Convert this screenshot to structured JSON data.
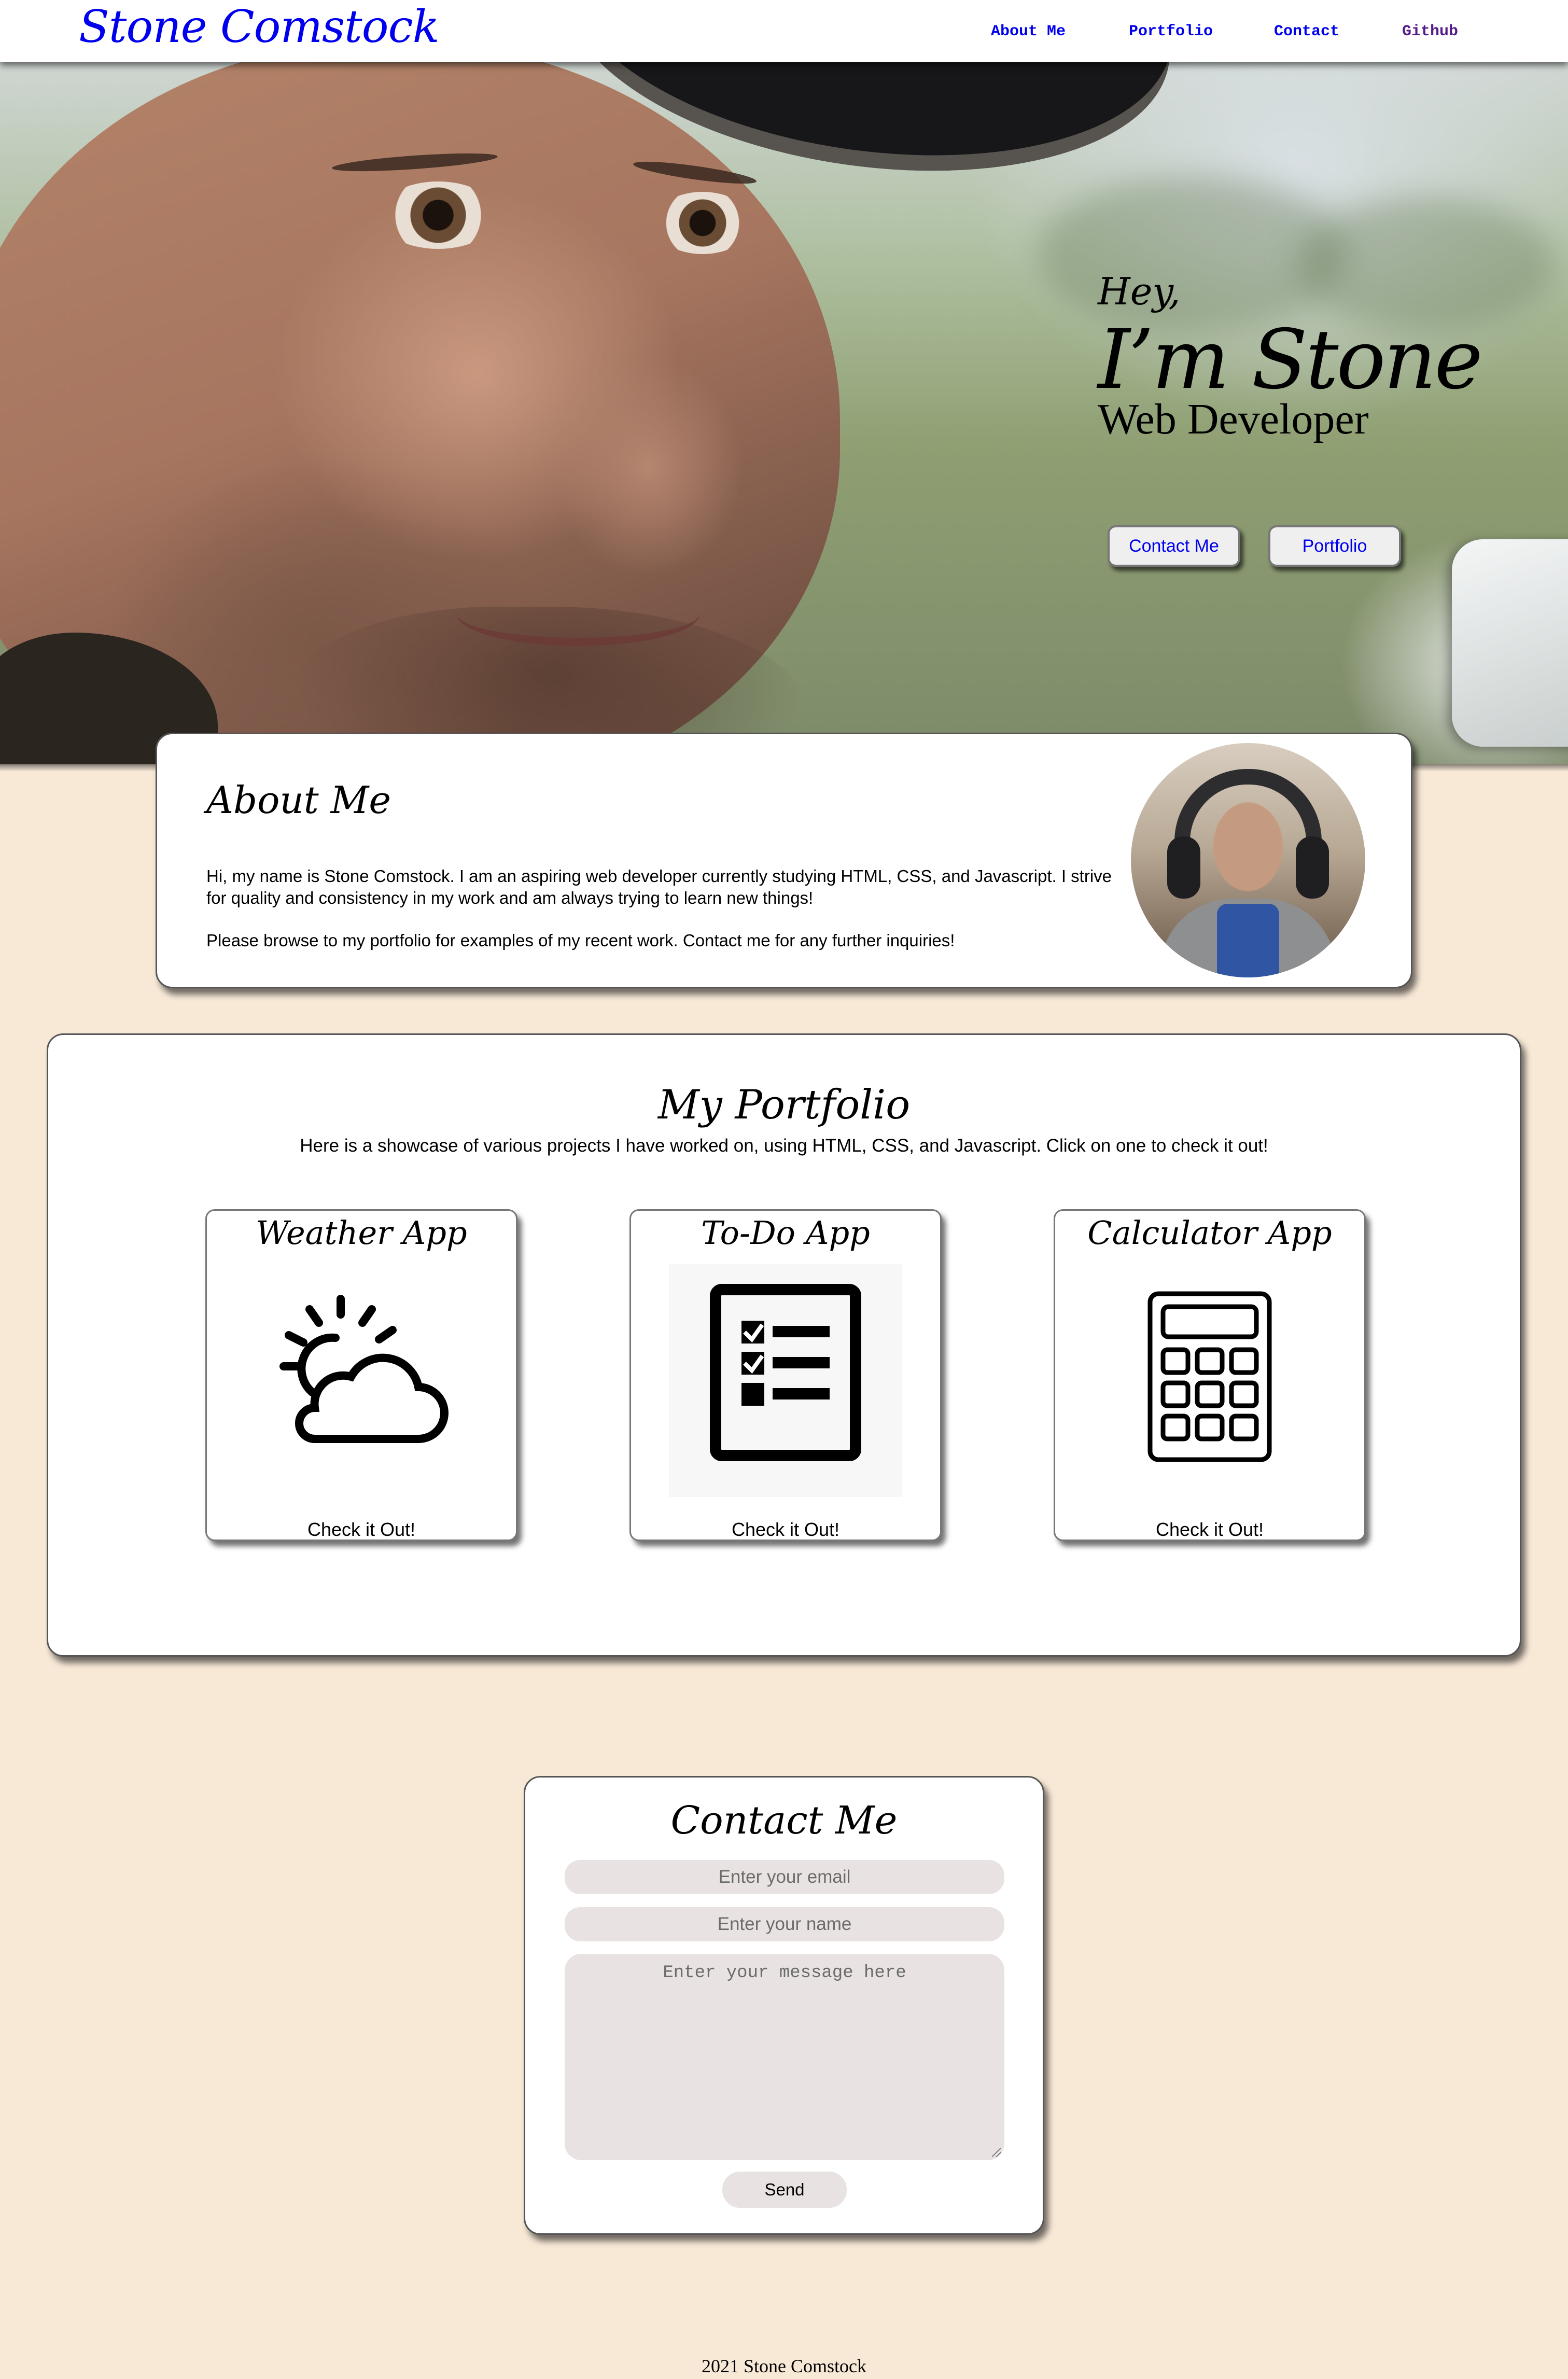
{
  "header": {
    "brand": "Stone Comstock",
    "nav": [
      {
        "label": "About Me"
      },
      {
        "label": "Portfolio"
      },
      {
        "label": "Contact"
      },
      {
        "label": "Github"
      }
    ]
  },
  "hero": {
    "greeting": "Hey,",
    "name": "I’m Stone",
    "role": "Web Developer",
    "contact_button": "Contact Me",
    "portfolio_button": "Portfolio"
  },
  "about": {
    "title": "About Me",
    "paragraph1": "Hi, my name is Stone Comstock. I am an aspiring web developer currently studying HTML, CSS, and Javascript. I strive for quality and consistency in my work and am always trying to learn new things!",
    "paragraph2": "Please browse to my portfolio for examples of my recent work. Contact me for any further inquiries!"
  },
  "portfolio": {
    "title": "My Portfolio",
    "subtitle": "Here is a showcase of various projects I have worked on, using HTML, CSS, and Javascript. Click on one to check it out!",
    "projects": [
      {
        "title": "Weather App",
        "link": "Check it Out!",
        "icon": "weather-icon"
      },
      {
        "title": "To-Do App",
        "link": "Check it Out!",
        "icon": "checklist-icon"
      },
      {
        "title": "Calculator App",
        "link": "Check it Out!",
        "icon": "calculator-icon"
      }
    ]
  },
  "contact": {
    "title": "Contact Me",
    "email_placeholder": "Enter your email",
    "name_placeholder": "Enter your name",
    "message_placeholder": "Enter your message here",
    "send_label": "Send"
  },
  "footer": {
    "text": "2021 Stone Comstock"
  },
  "colors": {
    "page_background": "#f8e9d7",
    "link": "#0000ee",
    "visited_link": "#551a8b",
    "field_background": "#e9e2e2"
  }
}
